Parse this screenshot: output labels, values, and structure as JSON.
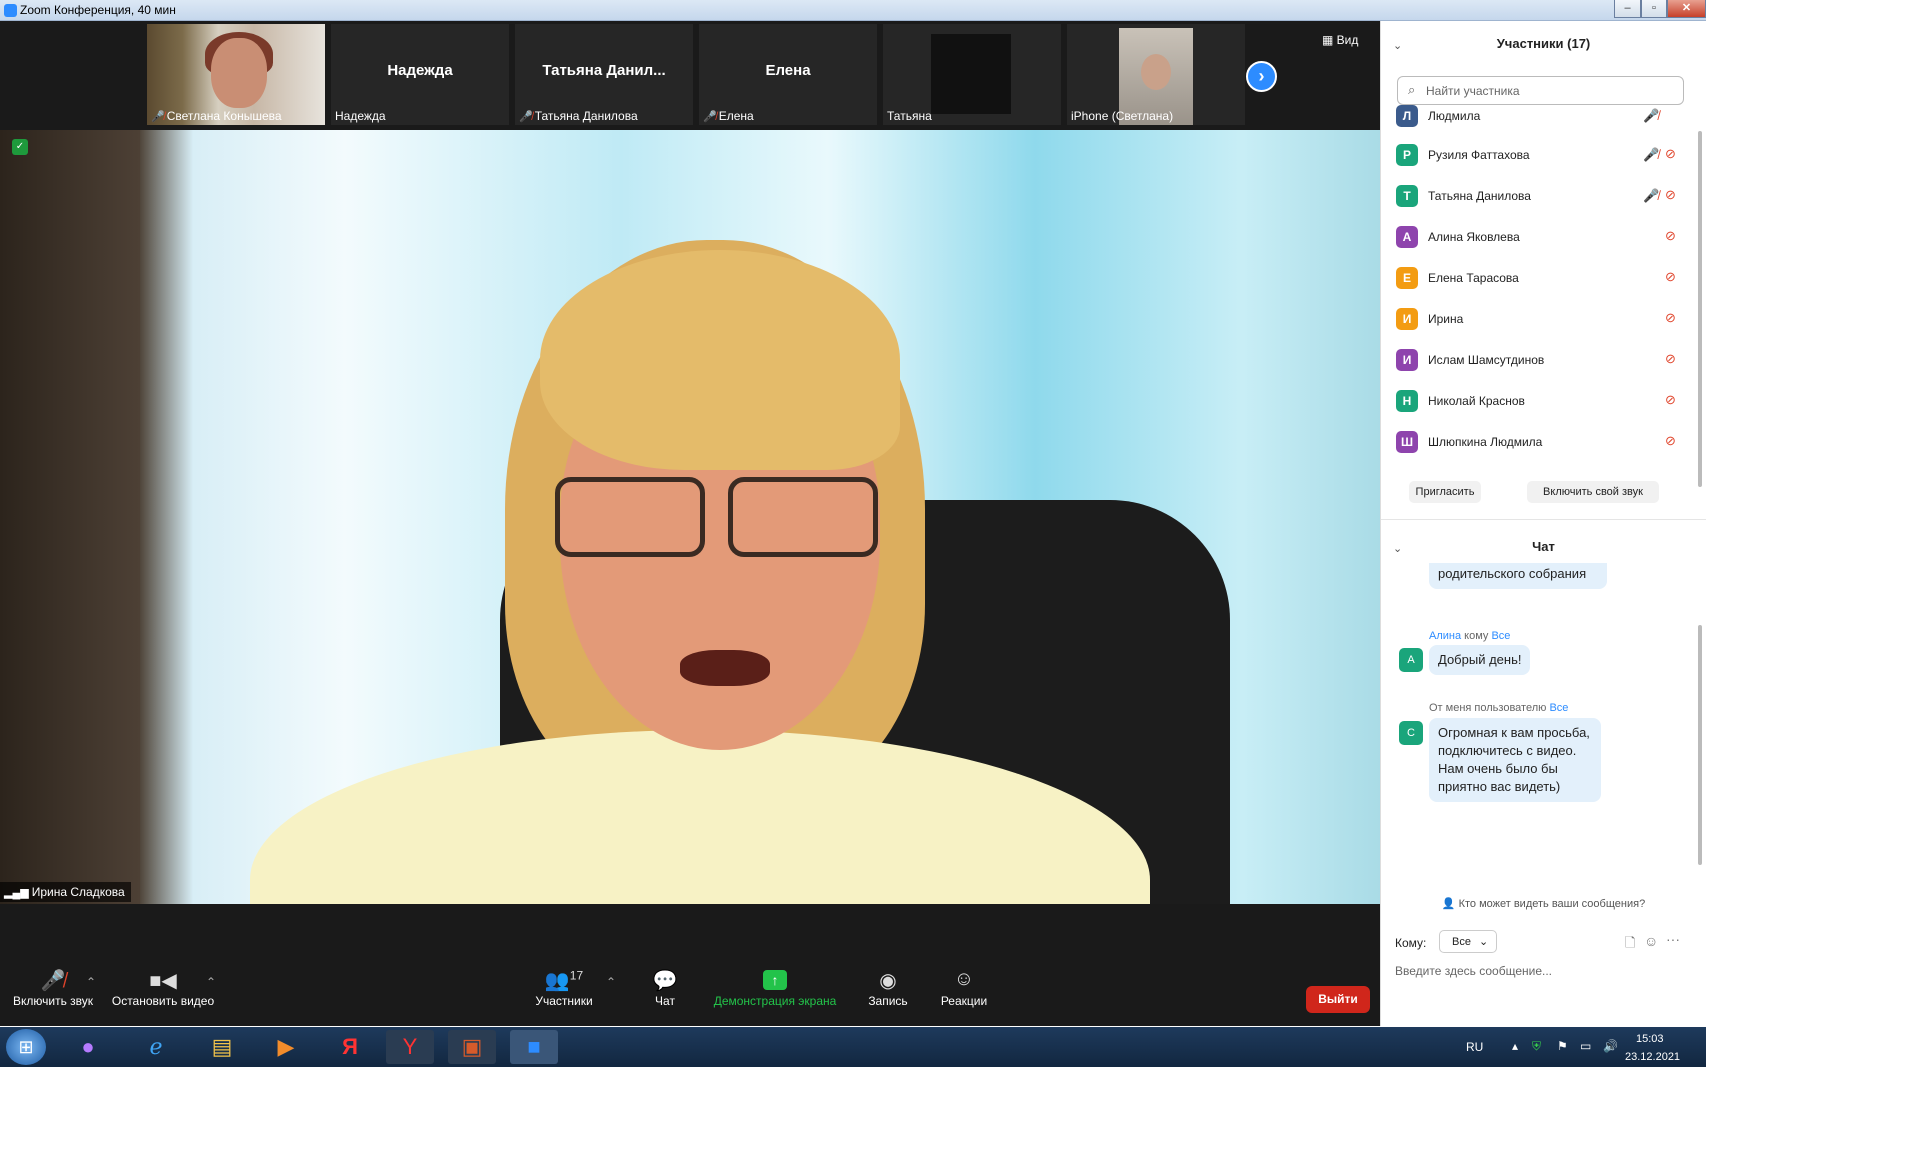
{
  "window": {
    "title": "Zoom Конференция, 40 мин",
    "minimize": "–",
    "restore": "▫",
    "close": "✕"
  },
  "thumbnails": [
    {
      "name": "Светлана Конышева",
      "big_name": "",
      "muted": true
    },
    {
      "name": "Надежда",
      "big_name": "Надежда",
      "muted": false
    },
    {
      "name": "Татьяна Данилова",
      "big_name": "Татьяна  Данил...",
      "muted": true
    },
    {
      "name": "Елена",
      "big_name": "Елена",
      "muted": true
    },
    {
      "name": "Татьяна",
      "big_name": "",
      "muted": false
    },
    {
      "name": "iPhone (Светлана)",
      "big_name": "",
      "muted": false
    }
  ],
  "view_button": "Вид",
  "next_icon": "›",
  "speaker": {
    "name": "Ирина Сладкова"
  },
  "toolbar": {
    "unmute": "Включить звук",
    "stop_video": "Остановить видео",
    "participants": "Участники",
    "participants_count": "17",
    "chat": "Чат",
    "share": "Демонстрация экрана",
    "record": "Запись",
    "reactions": "Реакции",
    "leave": "Выйти"
  },
  "participants_panel": {
    "title": "Участники (17)",
    "search_placeholder": "Найти участника",
    "rows": [
      {
        "initial": "Л",
        "name": "Людмила",
        "color": "#3b5b8c",
        "mic_muted": true,
        "cam_off": false
      },
      {
        "initial": "Р",
        "name": "Рузиля Фаттахова",
        "color": "#1aa57b",
        "mic_muted": true,
        "cam_off": true
      },
      {
        "initial": "Т",
        "name": "Татьяна Данилова",
        "color": "#1aa57b",
        "mic_muted": true,
        "cam_off": true
      },
      {
        "initial": "А",
        "name": "Алина Яковлева",
        "color": "#8e44ad",
        "mic_muted": false,
        "cam_off": true
      },
      {
        "initial": "Е",
        "name": "Елена Тарасова",
        "color": "#f39c12",
        "mic_muted": false,
        "cam_off": true
      },
      {
        "initial": "И",
        "name": "Ирина",
        "color": "#f39c12",
        "mic_muted": false,
        "cam_off": true
      },
      {
        "initial": "И",
        "name": "Ислам Шамсутдинов",
        "color": "#8e44ad",
        "mic_muted": false,
        "cam_off": true
      },
      {
        "initial": "Н",
        "name": "Николай Краснов",
        "color": "#1aa57b",
        "mic_muted": false,
        "cam_off": true
      },
      {
        "initial": "Ш",
        "name": "Шлюпкина Людмила",
        "color": "#8e44ad",
        "mic_muted": false,
        "cam_off": true
      }
    ],
    "invite": "Пригласить",
    "unmute_self": "Включить свой звук"
  },
  "chat_panel": {
    "title": "Чат",
    "prev_fragment": "родительского собрания",
    "messages": [
      {
        "avatar": "А",
        "from": "Алина",
        "mid": "кому",
        "to": "Все",
        "text": "Добрый день!"
      },
      {
        "avatar": "С",
        "from": "",
        "mid": "От меня пользователю",
        "to": "Все",
        "text": "Огромная к вам просьба, подключитесь с видео. Нам очень было бы приятно вас видеть)"
      }
    ],
    "who_sees": "Кто может видеть ваши сообщения?",
    "to_label": "Кому:",
    "to_value": "Все",
    "input_placeholder": "Введите здесь сообщение..."
  },
  "taskbar": {
    "lang": "RU",
    "time": "15:03",
    "date": "23.12.2021"
  }
}
